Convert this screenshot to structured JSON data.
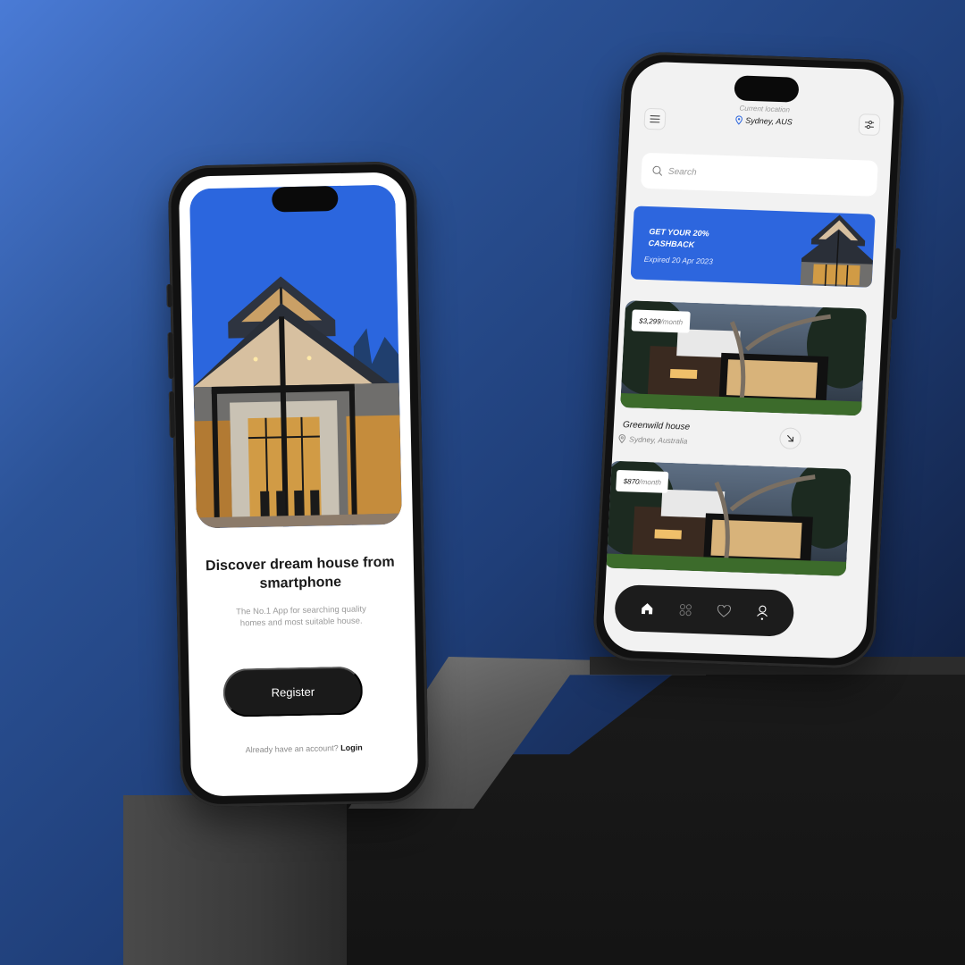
{
  "left_phone": {
    "headline": "Discover dream house from smartphone",
    "subtitle": "The No.1 App for searching quality homes and most suitable house.",
    "register_label": "Register",
    "login_prompt": "Already have an account?",
    "login_link": "Login",
    "hero_bg_color": "#2b66de"
  },
  "right_phone": {
    "header": {
      "location_label": "Current location",
      "location_value": "Sydney, AUS",
      "menu_icon": "hamburger-menu-icon",
      "filter_icon": "sliders-filter-icon"
    },
    "search": {
      "placeholder": "Search"
    },
    "promo": {
      "title_line1": "GET YOUR 20%",
      "title_line2": "CASHBACK",
      "expiry": "Expired 20 Apr 2023",
      "color": "#2d66de"
    },
    "listings": [
      {
        "price": "$3,299",
        "period": "/month",
        "name": "Greenwild house",
        "location": "Sydney, Australia"
      },
      {
        "price": "$870",
        "period": "/month"
      }
    ],
    "navbar": {
      "items": [
        {
          "icon": "home-icon",
          "active": true
        },
        {
          "icon": "grid-icon",
          "active": false
        },
        {
          "icon": "heart-icon",
          "active": false
        },
        {
          "icon": "profile-icon",
          "active": false
        }
      ]
    }
  }
}
